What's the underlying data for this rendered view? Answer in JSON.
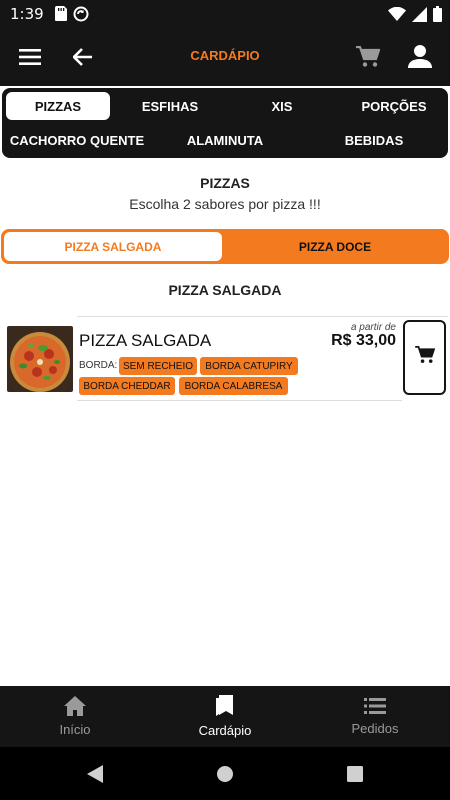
{
  "status_bar": {
    "time": "1:39"
  },
  "app_bar": {
    "title": "CARDÁPIO"
  },
  "categories": [
    {
      "label": "PIZZAS",
      "active": true
    },
    {
      "label": "ESFIHAS",
      "active": false
    },
    {
      "label": "XIS",
      "active": false
    },
    {
      "label": "PORÇÕES",
      "active": false
    },
    {
      "label": "CACHORRO QUENTE",
      "active": false
    },
    {
      "label": "ALAMINUTA",
      "active": false
    },
    {
      "label": "BEBIDAS",
      "active": false
    }
  ],
  "section": {
    "title": "PIZZAS",
    "subtitle": "Escolha 2 sabores por pizza !!!"
  },
  "segment": {
    "selected": "PIZZA SALGADA",
    "other": "PIZZA DOCE"
  },
  "group_title": "PIZZA SALGADA",
  "product": {
    "name": "PIZZA SALGADA",
    "price_prefix": "a partir de",
    "price": "R$ 33,00",
    "borda_label": "BORDA:",
    "options": [
      "SEM RECHEIO",
      "BORDA CATUPIRY",
      "BORDA CHEDDAR",
      "BORDA CALABRESA"
    ]
  },
  "bottom_nav": [
    {
      "label": "Início",
      "icon": "home-icon",
      "active": false
    },
    {
      "label": "Cardápio",
      "icon": "bookmark-icon",
      "active": true
    },
    {
      "label": "Pedidos",
      "icon": "list-icon",
      "active": false
    }
  ],
  "colors": {
    "accent": "#f47a20",
    "dark": "#151515",
    "inactive_nav": "#9a9a9a"
  }
}
